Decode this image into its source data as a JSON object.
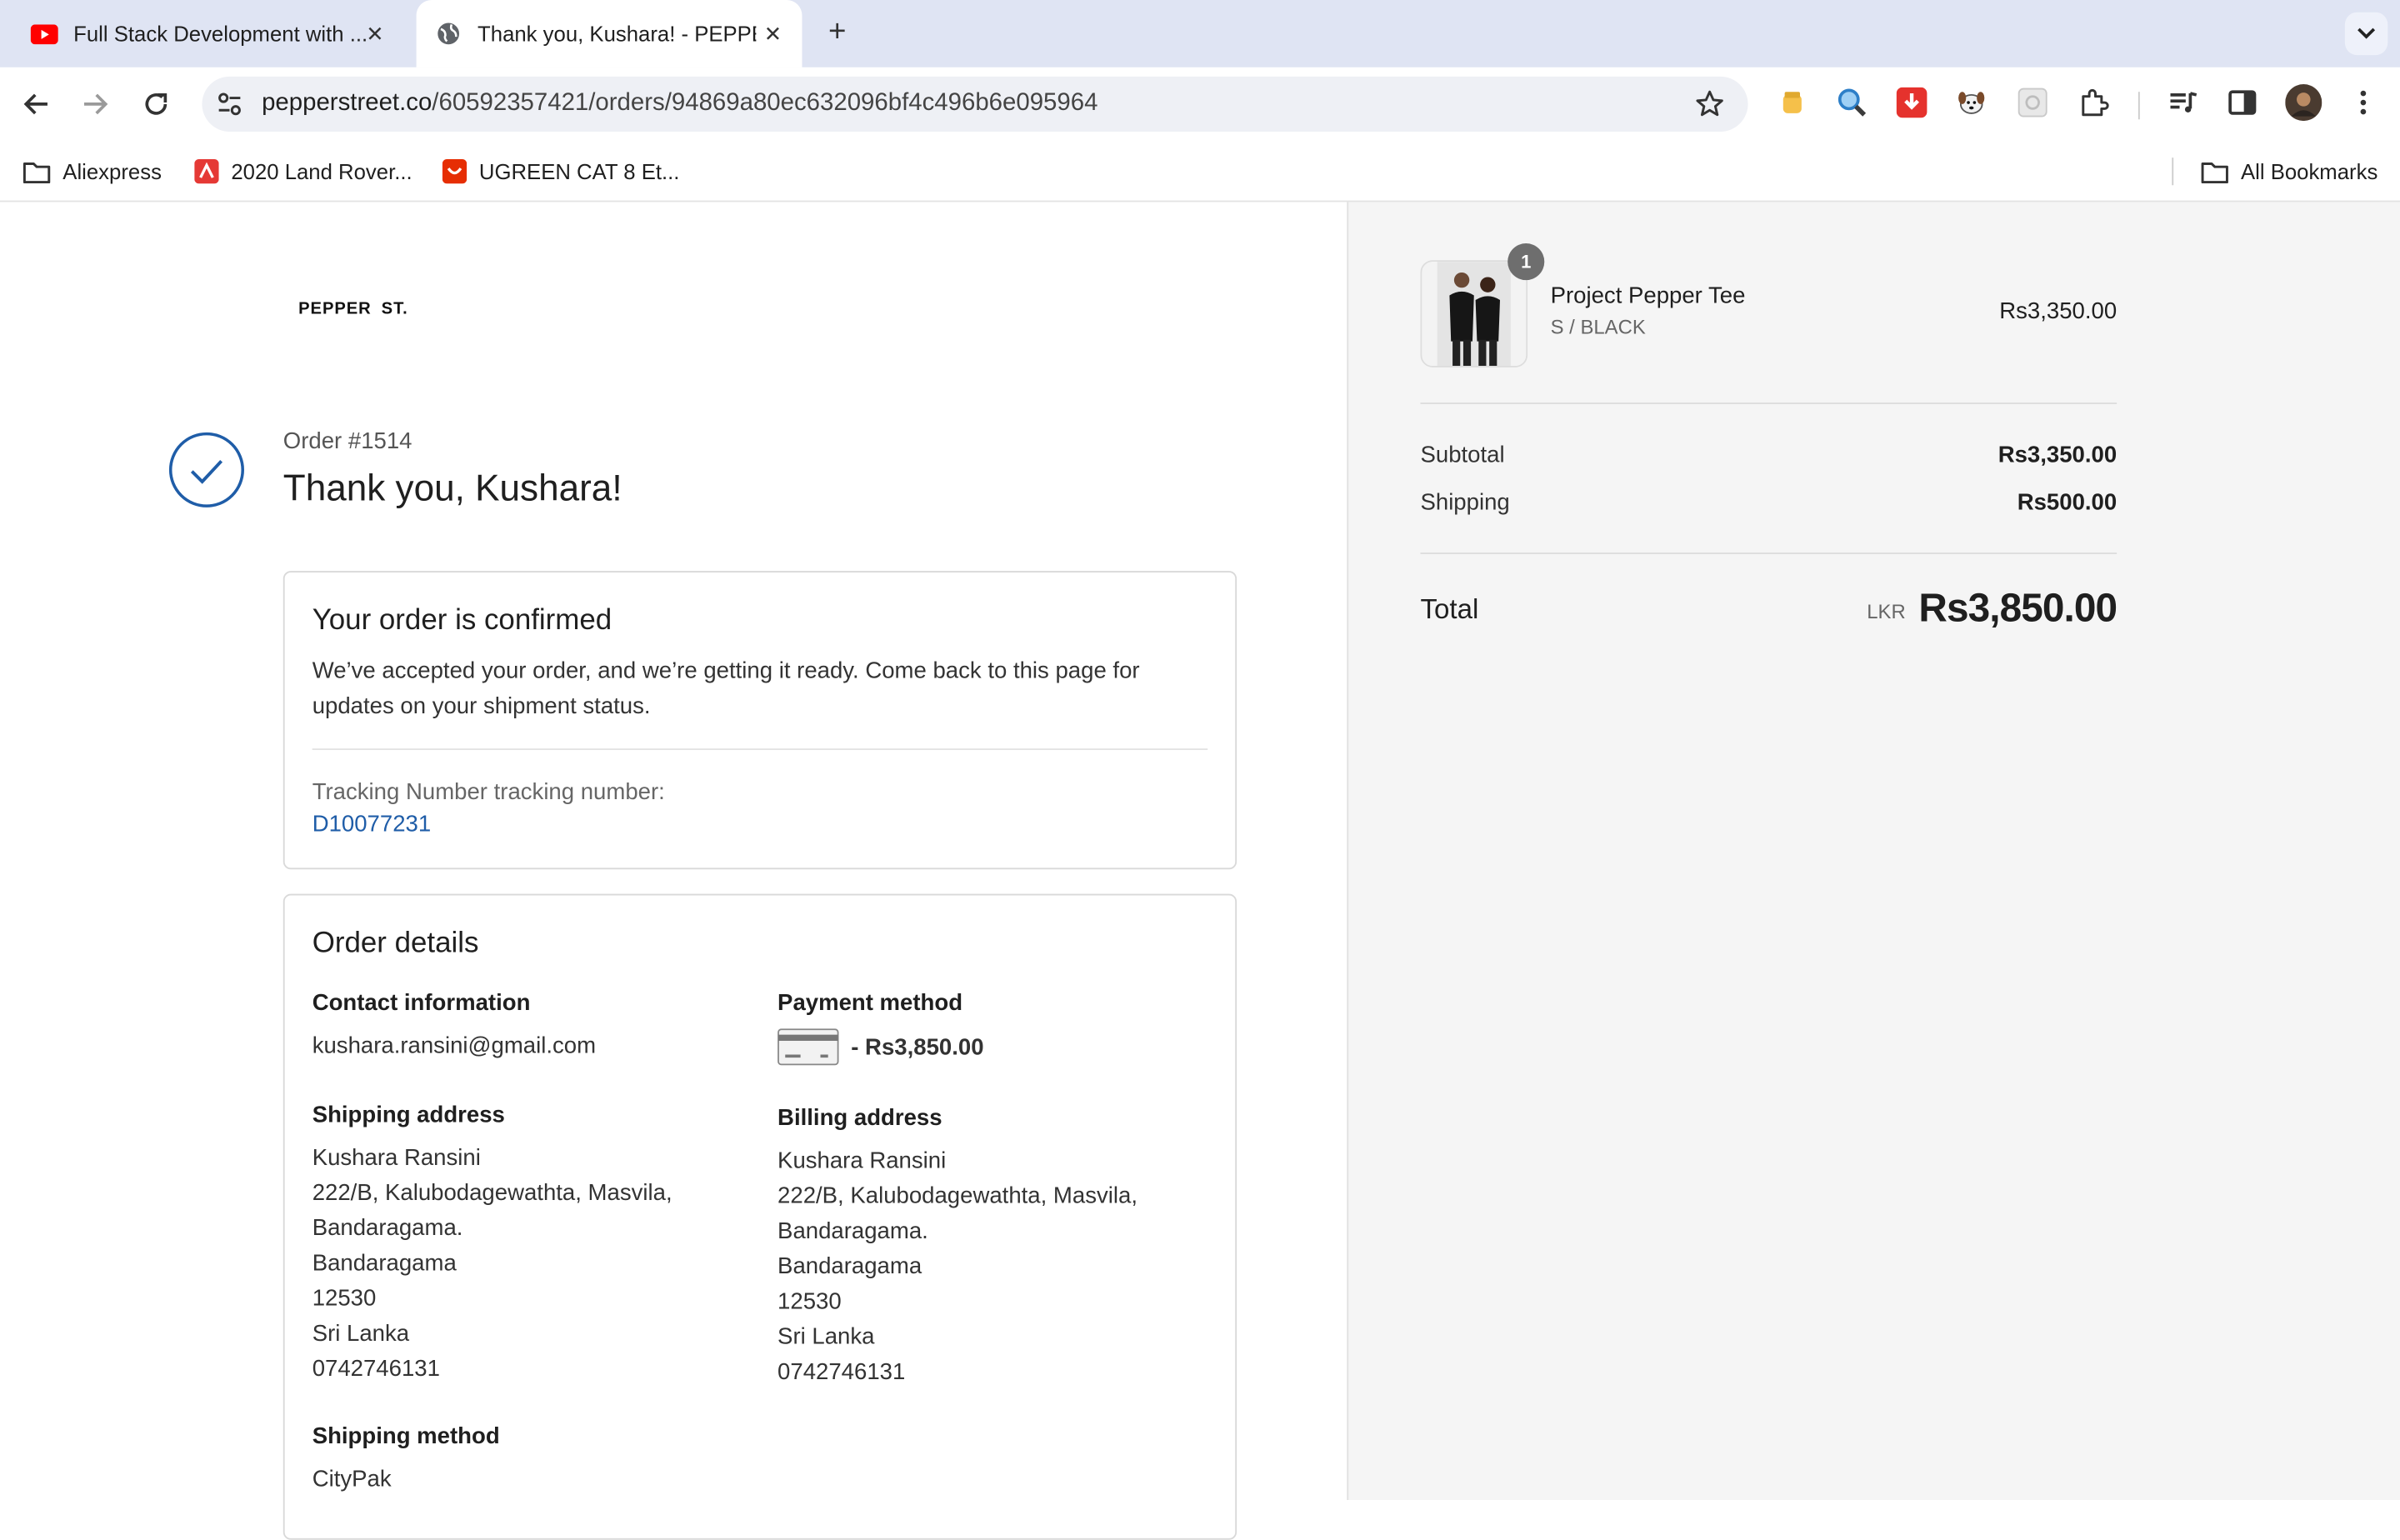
{
  "browser": {
    "tabs": [
      {
        "title": "Full Stack Development with ...",
        "icon": "youtube-icon",
        "active": false
      },
      {
        "title": "Thank you, Kushara! - PEPPER ST.",
        "icon": "globe-icon",
        "active": true
      }
    ],
    "url_domain": "pepperstreet.co",
    "url_path": "/60592357421/orders/94869a80ec632096bf4c496b6e095964",
    "bookmarks": [
      {
        "label": "Aliexpress",
        "icon": "folder-icon"
      },
      {
        "label": "2020 Land Rover...",
        "icon": "land-rover-icon"
      },
      {
        "label": "UGREEN CAT 8 Et...",
        "icon": "aliexpress-icon"
      }
    ],
    "all_bookmarks_label": "All Bookmarks"
  },
  "page": {
    "brand": "PEPPER ST.",
    "order_number": "Order #1514",
    "thank_you": "Thank you, Kushara!",
    "confirmation": {
      "title": "Your order is confirmed",
      "text": "We’ve accepted your order, and we’re getting it ready. Come back to this page for updates on your shipment status.",
      "tracking_label": "Tracking Number tracking number:",
      "tracking_number": "D10077231"
    },
    "details": {
      "title": "Order details",
      "contact_label": "Contact information",
      "contact_email": "kushara.ransini@gmail.com",
      "payment_label": "Payment method",
      "payment_amount": "- Rs3,850.00",
      "shipping_address_label": "Shipping address",
      "shipping_address": [
        "Kushara Ransini",
        "222/B, Kalubodagewathta, Masvila,",
        "Bandaragama.",
        "Bandaragama",
        "12530",
        "Sri Lanka",
        "0742746131"
      ],
      "billing_address_label": "Billing address",
      "billing_address": [
        "Kushara Ransini",
        "222/B, Kalubodagewathta, Masvila,",
        "Bandaragama.",
        "Bandaragama",
        "12530",
        "Sri Lanka",
        "0742746131"
      ],
      "shipping_method_label": "Shipping method",
      "shipping_method": "CityPak"
    }
  },
  "summary": {
    "product": {
      "name": "Project Pepper Tee",
      "variant": "S / BLACK",
      "price": "Rs3,350.00",
      "quantity": "1"
    },
    "subtotal_label": "Subtotal",
    "subtotal": "Rs3,350.00",
    "shipping_label": "Shipping",
    "shipping": "Rs500.00",
    "total_label": "Total",
    "currency": "LKR",
    "total": "Rs3,850.00"
  },
  "colors": {
    "accent": "#1f5da8",
    "tab_strip": "#dfe4f3",
    "summary_bg": "#f5f5f5"
  }
}
